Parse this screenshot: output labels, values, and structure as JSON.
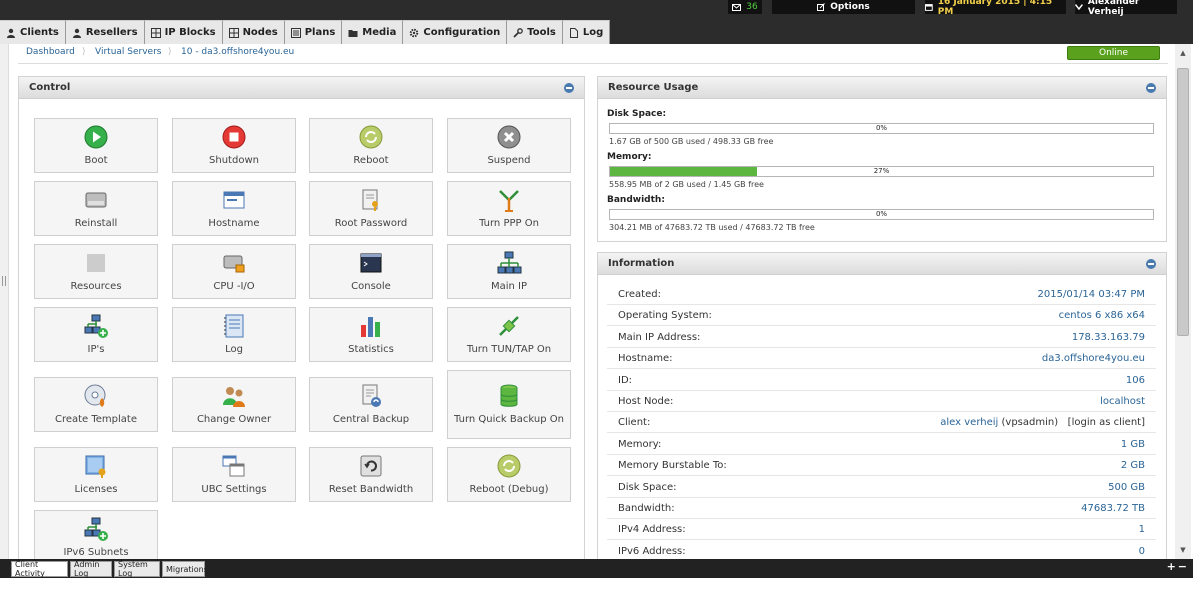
{
  "topbar": {
    "mail_count": "36",
    "options_label": "Options",
    "date_label": "16 January 2015 | 4:15 PM",
    "user_label": "Alexander Verheij"
  },
  "nav": [
    {
      "label": "Clients",
      "icon": "user-icon"
    },
    {
      "label": "Resellers",
      "icon": "user-icon"
    },
    {
      "label": "IP Blocks",
      "icon": "grid-icon"
    },
    {
      "label": "Nodes",
      "icon": "grid-icon"
    },
    {
      "label": "Plans",
      "icon": "list-icon"
    },
    {
      "label": "Media",
      "icon": "folder-icon"
    },
    {
      "label": "Configuration",
      "icon": "gear-icon"
    },
    {
      "label": "Tools",
      "icon": "wrench-icon"
    },
    {
      "label": "Log",
      "icon": "document-icon"
    }
  ],
  "breadcrumb": [
    "Dashboard",
    "Virtual Servers",
    "10 - da3.offshore4you.eu"
  ],
  "status_badge": "Online",
  "control": {
    "title": "Control",
    "buttons": [
      {
        "label": "Boot",
        "icon": "play-icon"
      },
      {
        "label": "Shutdown",
        "icon": "stop-icon"
      },
      {
        "label": "Reboot",
        "icon": "refresh-icon"
      },
      {
        "label": "Suspend",
        "icon": "x-circle-icon"
      },
      {
        "label": "Reinstall",
        "icon": "drive-icon"
      },
      {
        "label": "Hostname",
        "icon": "window-icon"
      },
      {
        "label": "Root Password",
        "icon": "key-doc-icon"
      },
      {
        "label": "Turn PPP On",
        "icon": "antenna-icon"
      },
      {
        "label": "Resources",
        "icon": "folder-icon"
      },
      {
        "label": "CPU -I/O",
        "icon": "drive-lock-icon"
      },
      {
        "label": "Console",
        "icon": "terminal-icon"
      },
      {
        "label": "Main IP",
        "icon": "network-icon"
      },
      {
        "label": "IP's",
        "icon": "network-add-icon"
      },
      {
        "label": "Log",
        "icon": "notebook-icon"
      },
      {
        "label": "Statistics",
        "icon": "bar-chart-icon"
      },
      {
        "label": "Turn TUN/TAP On",
        "icon": "plug-icon"
      },
      {
        "label": "Create Template",
        "icon": "disc-icon"
      },
      {
        "label": "Change Owner",
        "icon": "users-icon"
      },
      {
        "label": "Central Backup",
        "icon": "backup-doc-icon"
      },
      {
        "label": "Turn Quick Backup On",
        "icon": "database-icon"
      },
      {
        "label": "Licenses",
        "icon": "license-icon"
      },
      {
        "label": "UBC Settings",
        "icon": "windows-icon"
      },
      {
        "label": "Reset Bandwidth",
        "icon": "reset-icon"
      },
      {
        "label": "Reboot (Debug)",
        "icon": "refresh-icon"
      },
      {
        "label": "IPv6 Subnets",
        "icon": "network-add-icon"
      }
    ]
  },
  "resource_usage": {
    "title": "Resource Usage",
    "items": [
      {
        "label": "Disk Space:",
        "percent": 0,
        "percent_label": "0%",
        "detail": "1.67 GB of 500 GB used / 498.33 GB free"
      },
      {
        "label": "Memory:",
        "percent": 27,
        "percent_label": "27%",
        "detail": "558.95 MB of 2 GB used / 1.45 GB free"
      },
      {
        "label": "Bandwidth:",
        "percent": 0,
        "percent_label": "0%",
        "detail": "304.21 MB of 47683.72 TB used / 47683.72 TB free"
      }
    ]
  },
  "information": {
    "title": "Information",
    "rows": [
      {
        "key": "Created:",
        "value": "2015/01/14 03:47 PM"
      },
      {
        "key": "Operating System:",
        "value": "centos 6 x86 x64"
      },
      {
        "key": "Main IP Address:",
        "value": "178.33.163.79"
      },
      {
        "key": "Hostname:",
        "value": "da3.offshore4you.eu"
      },
      {
        "key": "ID:",
        "value": "106"
      },
      {
        "key": "Host Node:",
        "value": "localhost"
      },
      {
        "key": "Client:",
        "value": "alex verheij",
        "value_suffix": "(vpsadmin)",
        "action": "[login as client]"
      },
      {
        "key": "Memory:",
        "value": "1 GB"
      },
      {
        "key": "Memory Burstable To:",
        "value": "2 GB"
      },
      {
        "key": "Disk Space:",
        "value": "500 GB"
      },
      {
        "key": "Bandwidth:",
        "value": "47683.72 TB"
      },
      {
        "key": "IPv4 Address:",
        "value": "1"
      },
      {
        "key": "IPv6 Address:",
        "value": "0"
      }
    ]
  },
  "bottom_tabs": [
    "Client Activity",
    "Admin Log",
    "System Log",
    "Migrations"
  ],
  "colors": {
    "online": "#5aa21d",
    "memory_bar": "#5cb63f",
    "link": "#2a6496"
  }
}
